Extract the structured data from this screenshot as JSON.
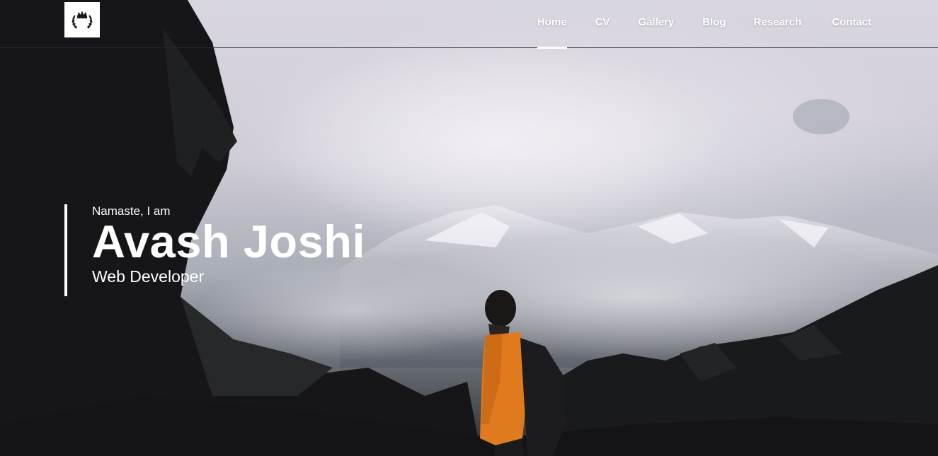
{
  "nav": {
    "logo_icon": "crown-laurel-icon",
    "items": [
      {
        "label": "Home",
        "active": true
      },
      {
        "label": "CV",
        "active": false
      },
      {
        "label": "Gallery",
        "active": false
      },
      {
        "label": "Blog",
        "active": false
      },
      {
        "label": "Research",
        "active": false
      },
      {
        "label": "Contact",
        "active": false
      }
    ]
  },
  "hero": {
    "greeting": "Namaste, I am",
    "name": "Avash Joshi",
    "role": "Web Developer",
    "background": "hiker-in-misty-mountains-photo"
  },
  "colors": {
    "text": "#ffffff",
    "nav_border": "#282838",
    "forest_dark": "#1a1a1c",
    "jacket_orange": "#e07a1f"
  }
}
